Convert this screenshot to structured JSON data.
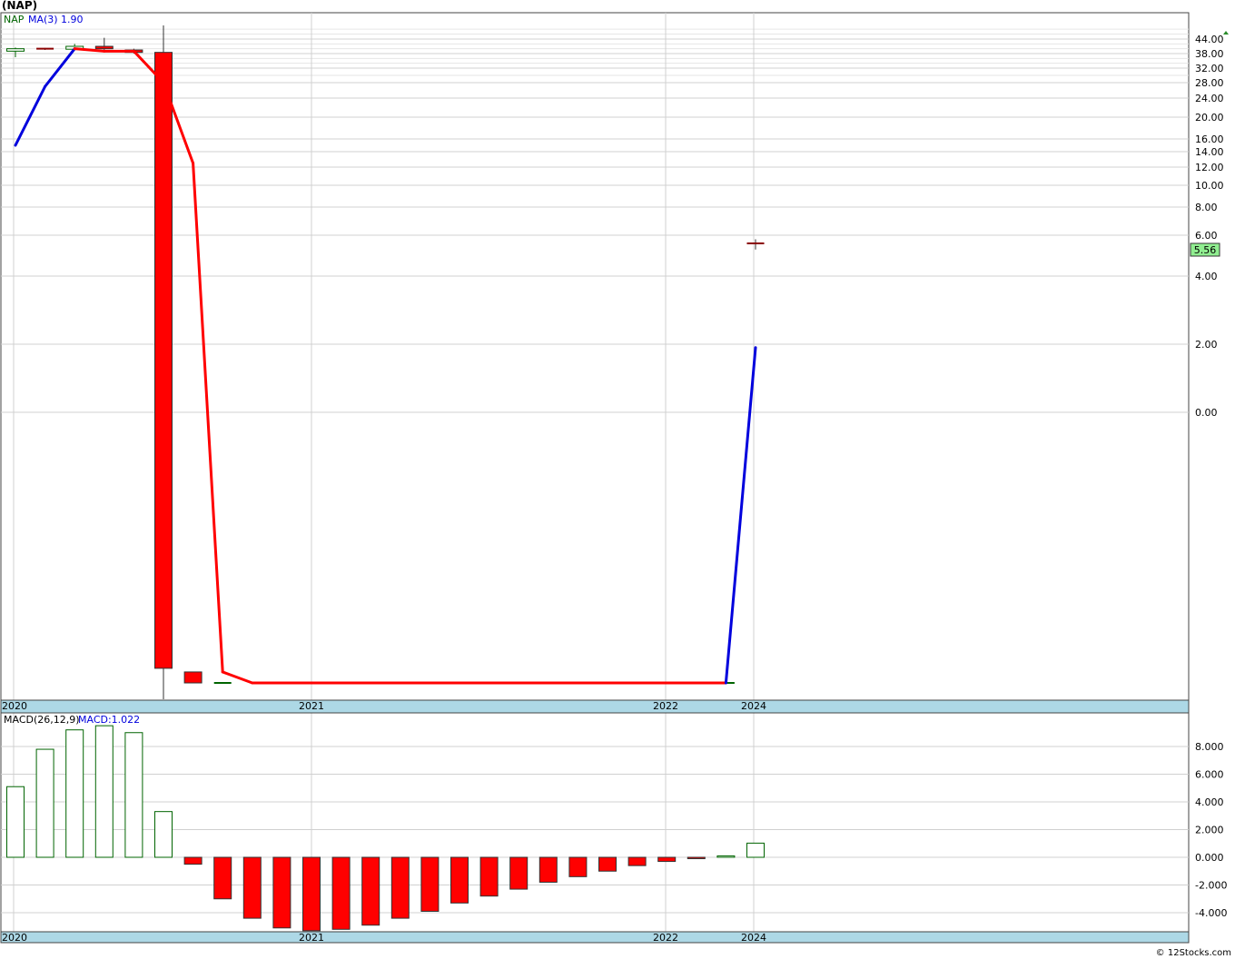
{
  "title": "(NAP)",
  "watermark": "© 12Stocks.com",
  "colors": {
    "up": "#006400",
    "down": "#ff0000",
    "ma": "#0000dd",
    "axis_band": "#add8e6",
    "last_price_bg": "#90ee90",
    "grid": "#dddddd"
  },
  "chart_data": [
    {
      "type": "candlestick",
      "legend": {
        "symbol": "NAP",
        "ma_label": "MA(3)",
        "ma_value": "1.90"
      },
      "last_price_label": "5.56",
      "x_tick_labels": [
        "2020",
        "2021",
        "2022",
        "2024"
      ],
      "y_tick_labels": [
        "44.00",
        "38.00",
        "32.00",
        "28.00",
        "24.00",
        "20.00",
        "16.00",
        "14.00",
        "12.00",
        "10.00",
        "8.00",
        "6.00",
        "4.00",
        "2.00",
        "0.00"
      ],
      "candles": [
        {
          "o": 39.0,
          "h": 40.5,
          "l": 36.5,
          "c": 40.0
        },
        {
          "o": 40.0,
          "h": 40.3,
          "l": 39.5,
          "c": 39.6
        },
        {
          "o": 39.8,
          "h": 42.0,
          "l": 39.5,
          "c": 41.0
        },
        {
          "o": 41.0,
          "h": 45.0,
          "l": 39.5,
          "c": 40.0
        },
        {
          "o": 39.5,
          "h": 40.0,
          "l": 38.0,
          "c": 38.5
        },
        {
          "o": 38.5,
          "h": 55.0,
          "l": -20.0,
          "c": -14.0
        },
        {
          "o": -14.2,
          "h": -14.2,
          "l": -14.8,
          "c": -14.8
        },
        {
          "o": -14.8,
          "h": -14.8,
          "l": -14.8,
          "c": -14.8
        },
        null,
        null,
        null,
        null,
        null,
        null,
        null,
        null,
        null,
        null,
        null,
        null,
        null,
        null,
        null,
        null,
        {
          "o": -14.8,
          "h": -14.8,
          "l": -14.8,
          "c": -14.8
        },
        {
          "o": 5.6,
          "h": 5.8,
          "l": 5.3,
          "c": 5.56
        }
      ],
      "ma": [
        15.0,
        27.0,
        40.0,
        39.0,
        39.0,
        28.0,
        12.5,
        -14.2,
        -14.8,
        -14.8,
        -14.8,
        -14.8,
        -14.8,
        -14.8,
        -14.8,
        -14.8,
        -14.8,
        -14.8,
        -14.8,
        -14.8,
        -14.8,
        -14.8,
        -14.8,
        -14.8,
        -14.8,
        1.9
      ]
    },
    {
      "type": "bar",
      "legend": {
        "label": "MACD(26,12,9)",
        "value_label": "MACD:1.022"
      },
      "x_tick_labels": [
        "2020",
        "2021",
        "2022",
        "2024"
      ],
      "y_tick_labels": [
        "8.000",
        "6.000",
        "4.000",
        "2.000",
        "0.000",
        "-2.000",
        "-4.000"
      ],
      "values": [
        5.1,
        7.8,
        9.2,
        9.5,
        9.0,
        3.3,
        -0.5,
        -3.0,
        -4.4,
        -5.1,
        -5.3,
        -5.2,
        -4.9,
        -4.4,
        -3.9,
        -3.3,
        -2.8,
        -2.3,
        -1.8,
        -1.4,
        -1.0,
        -0.6,
        -0.3,
        -0.1,
        0.1,
        1.022
      ]
    }
  ]
}
